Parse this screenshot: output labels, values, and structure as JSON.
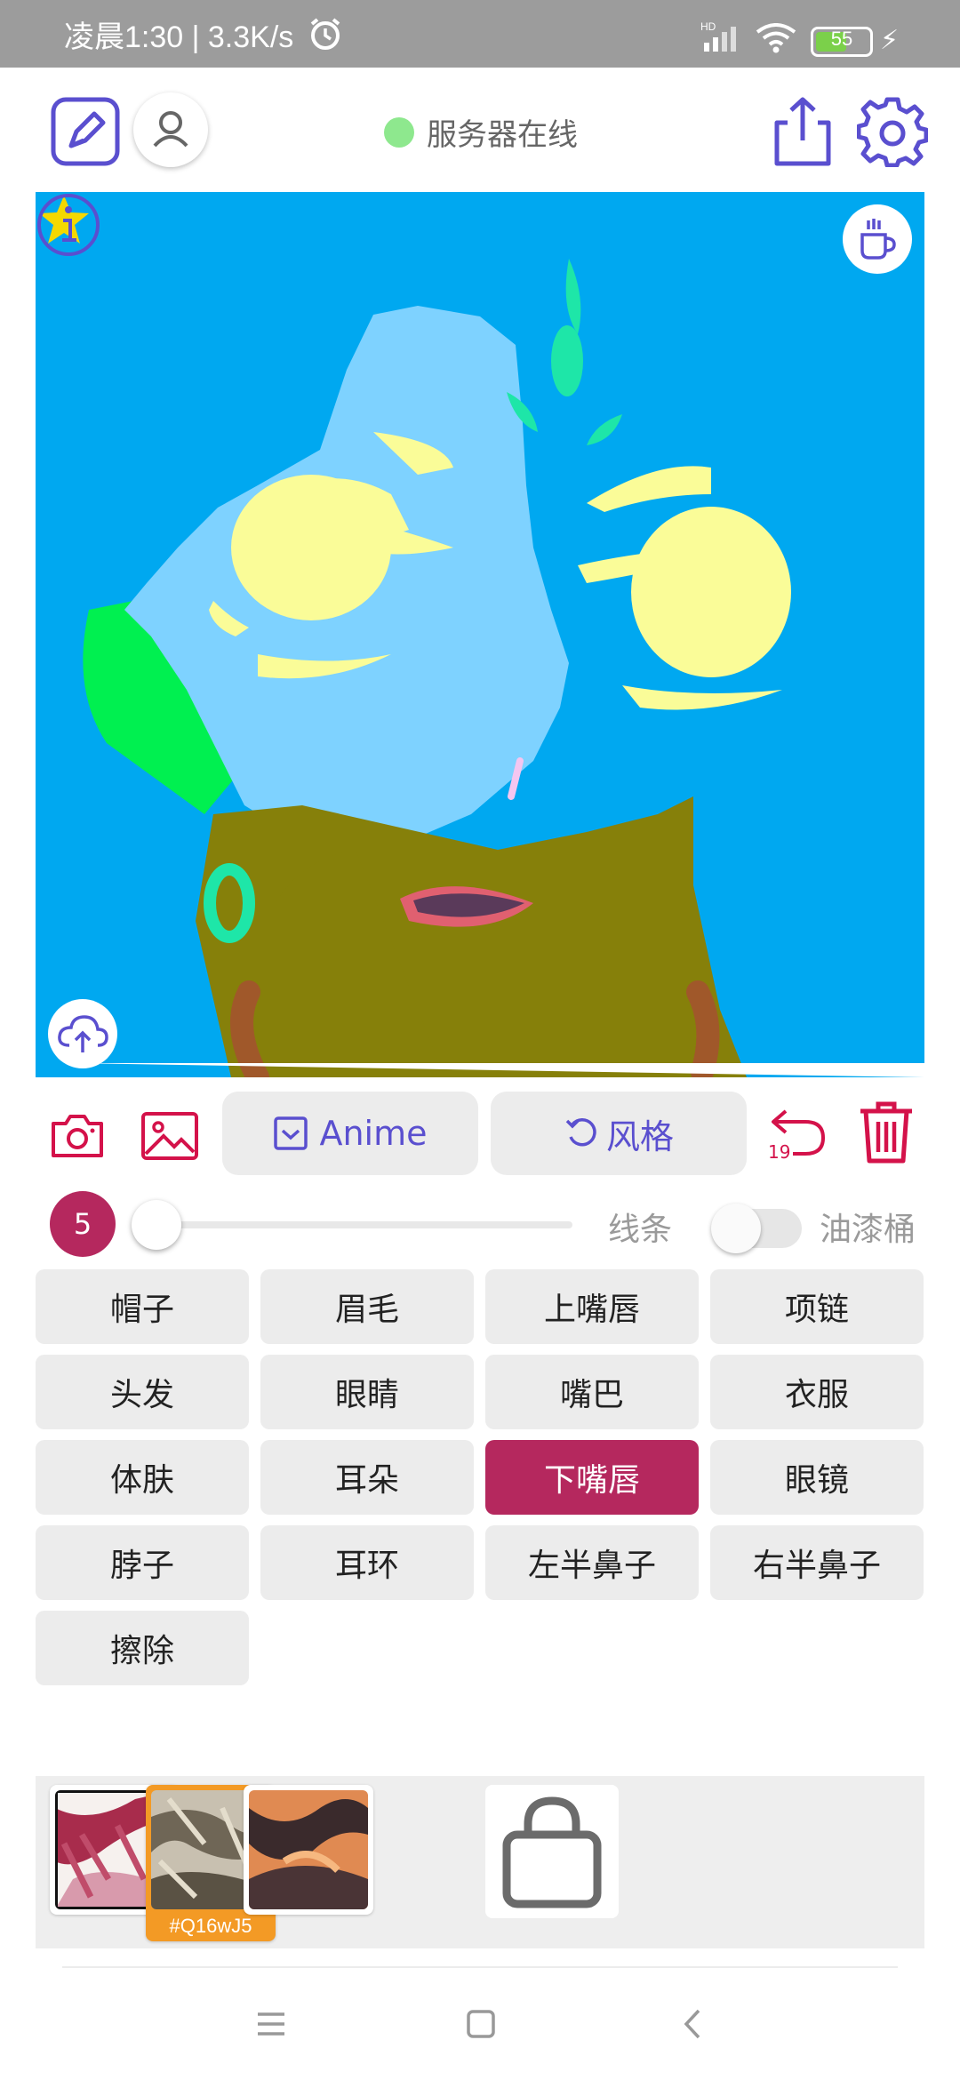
{
  "status_bar": {
    "time": "凌晨1:30 | 3.3K/s",
    "network_type": "HD",
    "battery_level": "55"
  },
  "header": {
    "server_status": "服务器在线",
    "server_status_color": "#8ee88e",
    "accent_color": "#5a4fcf"
  },
  "toolbar": {
    "anime_label": "Anime",
    "style_label": "风格",
    "undo_count": "19"
  },
  "brush": {
    "size": "5",
    "line_label": "线条",
    "bucket_label": "油漆桶",
    "bucket_enabled": false
  },
  "parts": [
    {
      "label": "帽子",
      "selected": false
    },
    {
      "label": "眉毛",
      "selected": false
    },
    {
      "label": "上嘴唇",
      "selected": false
    },
    {
      "label": "项链",
      "selected": false
    },
    {
      "label": "头发",
      "selected": false
    },
    {
      "label": "眼睛",
      "selected": false
    },
    {
      "label": "嘴巴",
      "selected": false
    },
    {
      "label": "衣服",
      "selected": false
    },
    {
      "label": "体肤",
      "selected": false
    },
    {
      "label": "耳朵",
      "selected": false
    },
    {
      "label": "下嘴唇",
      "selected": true
    },
    {
      "label": "眼镜",
      "selected": false
    },
    {
      "label": "脖子",
      "selected": false
    },
    {
      "label": "耳环",
      "selected": false
    },
    {
      "label": "左半鼻子",
      "selected": false
    },
    {
      "label": "右半鼻子",
      "selected": false
    },
    {
      "label": "擦除",
      "selected": false
    }
  ],
  "styles": {
    "selected_code": "#Q16wJ5",
    "selected_color": "#f39a25"
  }
}
